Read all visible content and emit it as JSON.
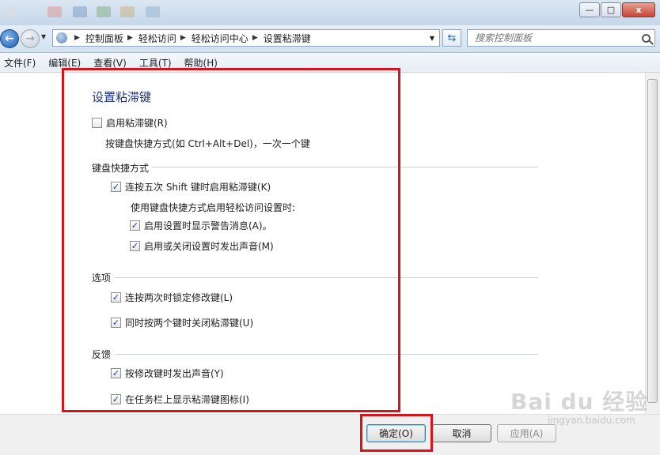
{
  "window": {
    "minimize_glyph": "—",
    "maximize_glyph": "□",
    "close_glyph": "x"
  },
  "address_bar": {
    "breadcrumb": [
      "控制面板",
      "轻松访问",
      "轻松访问中心",
      "设置粘滞键"
    ],
    "search_placeholder": "搜索控制面板"
  },
  "menu": [
    "文件(F)",
    "编辑(E)",
    "查看(V)",
    "工具(T)",
    "帮助(H)"
  ],
  "page": {
    "title": "设置粘滞键",
    "enable": {
      "label": "启用粘滞键(R)",
      "checked": false
    },
    "enable_desc": "按键盘快捷方式(如 Ctrl+Alt+Del)，一次一个键",
    "shortcut_section": {
      "heading": "键盘快捷方式",
      "five_shift": {
        "label": "连按五次 Shift 键时启用粘滞键(K)",
        "checked": true
      },
      "sub_heading": "使用键盘快捷方式启用轻松访问设置时:",
      "warning": {
        "label": "启用设置时显示警告消息(A)。",
        "checked": true
      },
      "sound": {
        "label": "启用或关闭设置时发出声音(M)",
        "checked": true
      }
    },
    "options_section": {
      "heading": "选项",
      "lock_twice": {
        "label": "连按两次时锁定修改键(L)",
        "checked": true
      },
      "turn_off_two": {
        "label": "同时按两个键时关闭粘滞键(U)",
        "checked": true
      }
    },
    "feedback_section": {
      "heading": "反馈",
      "beep": {
        "label": "按修改键时发出声音(Y)",
        "checked": true
      },
      "taskbar_icon": {
        "label": "在任务栏上显示粘滞键图标(I)",
        "checked": true
      }
    }
  },
  "buttons": {
    "ok": "确定(O)",
    "cancel": "取消",
    "apply": "应用(A)"
  },
  "watermark": {
    "logo": "Bai du 经验",
    "sub": "jingyan.baidu.com"
  },
  "colors": {
    "highlight_red": "#d5141c",
    "title_blue": "#1e3287"
  }
}
